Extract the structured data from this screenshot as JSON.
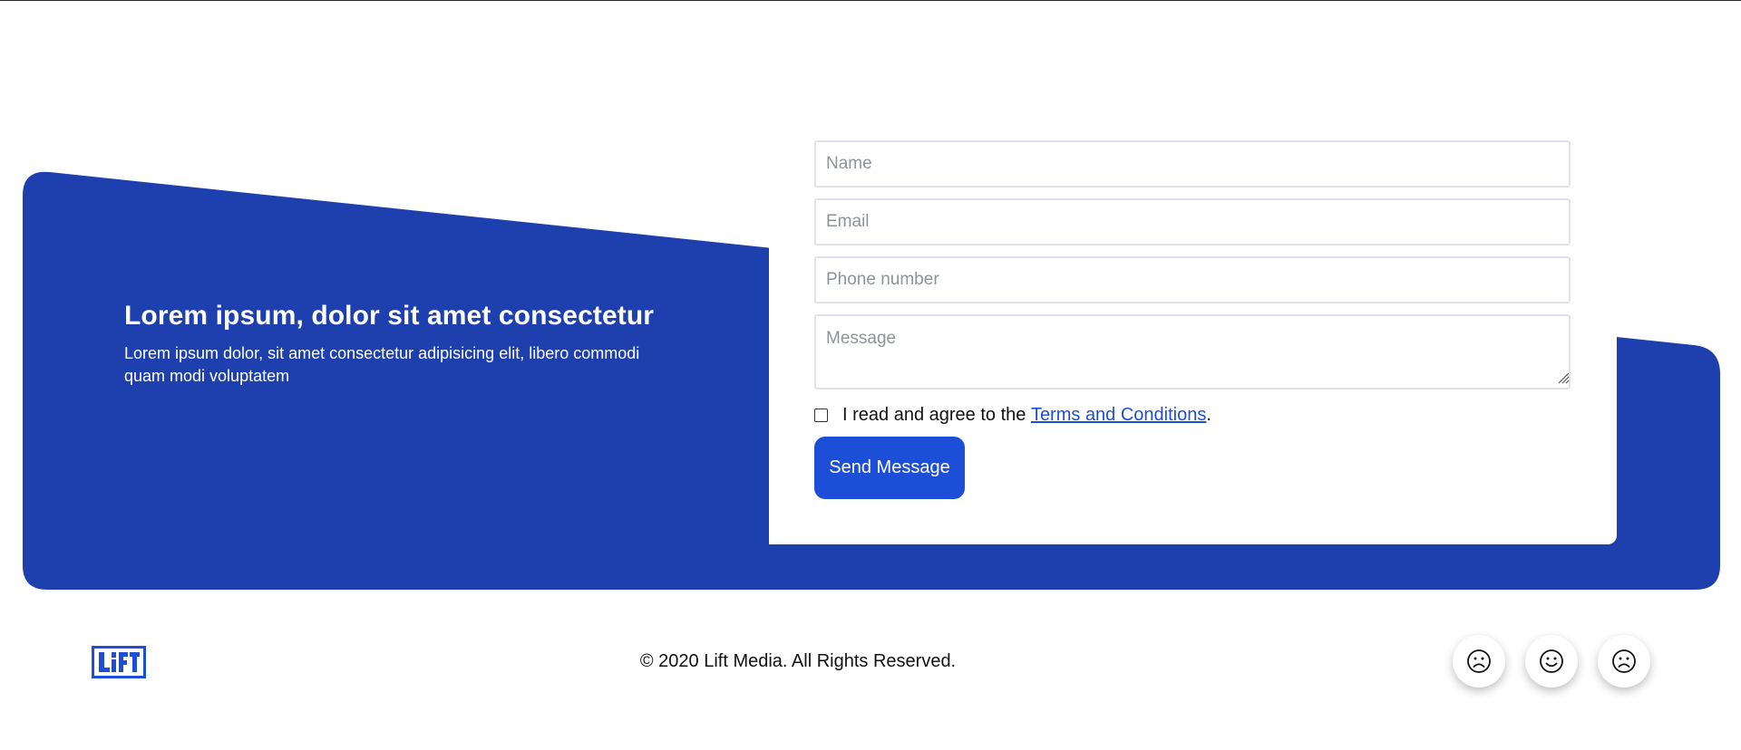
{
  "hero": {
    "title": "Lorem ipsum, dolor sit amet consectetur",
    "subtitle": "Lorem ipsum dolor, sit amet consectetur adipisicing elit, libero commodi quam modi voluptatem"
  },
  "form": {
    "name_placeholder": "Name",
    "email_placeholder": "Email",
    "phone_placeholder": "Phone number",
    "message_placeholder": "Message",
    "agree_prefix": "I read and agree to the ",
    "terms_link": "Terms and Conditions",
    "agree_suffix": ".",
    "agree_checked": false,
    "submit_label": "Send Message"
  },
  "footer": {
    "logo_text": "LIFT",
    "copyright": "© 2020 Lift Media. All Rights Reserved.",
    "social": [
      {
        "icon": "frown-face-icon"
      },
      {
        "icon": "smile-face-icon"
      },
      {
        "icon": "frown-face-icon"
      }
    ]
  },
  "colors": {
    "brand_blue": "#1e40af",
    "button_blue": "#1d4ed8"
  }
}
